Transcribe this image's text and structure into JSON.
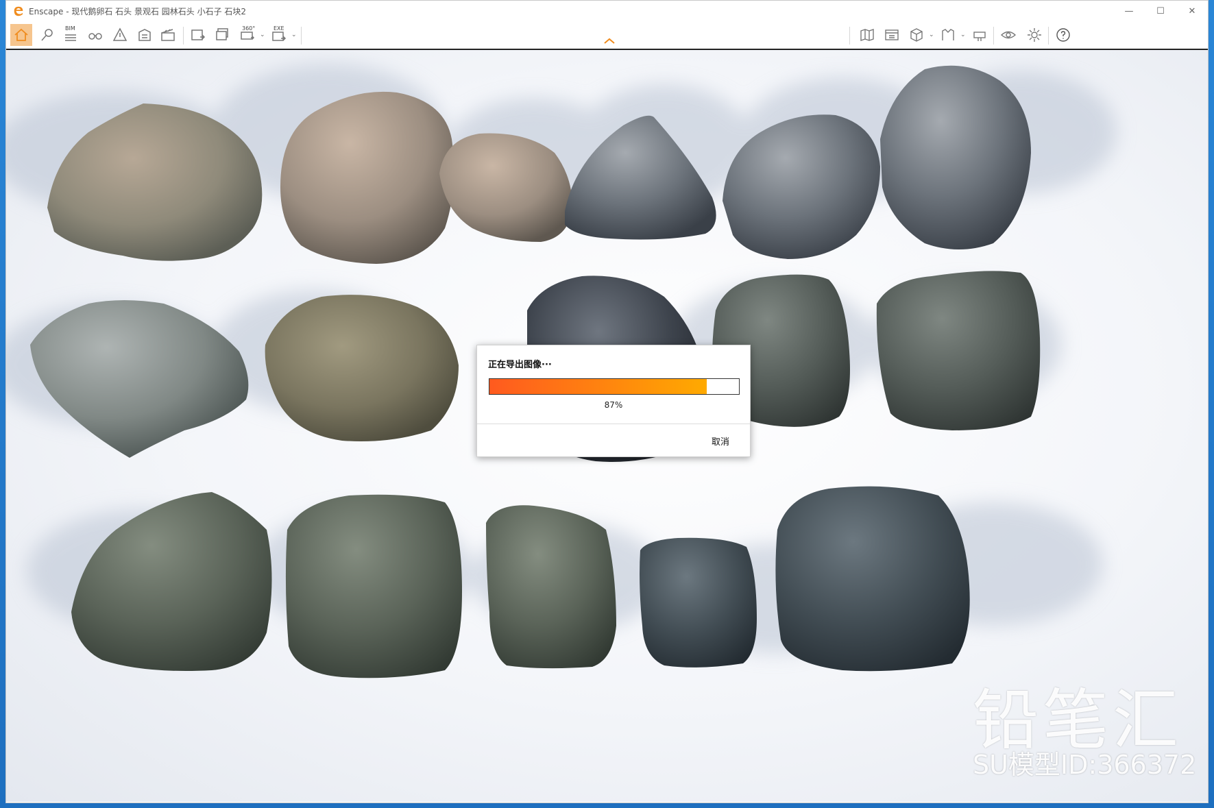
{
  "window": {
    "title": "Enscape - 现代鹅卵石 石头 景观石 园林石头 小石子 石块2",
    "controls": {
      "minimize": "—",
      "maximize": "☐",
      "close": "✕"
    }
  },
  "toolbar": {
    "bim_label": "BIM",
    "pano_label": "360°",
    "exe_label": "EXE",
    "active_tool": "home"
  },
  "export_dialog": {
    "title": "正在导出图像···",
    "progress_percent": 87,
    "progress_text": "87%",
    "cancel_label": "取消"
  },
  "watermark": {
    "brand": "铅笔汇",
    "model_id": "SU模型ID:366372"
  },
  "colors": {
    "accent": "#f08c1e",
    "progress_start": "#ff5a1f",
    "progress_end": "#ffaa00"
  }
}
